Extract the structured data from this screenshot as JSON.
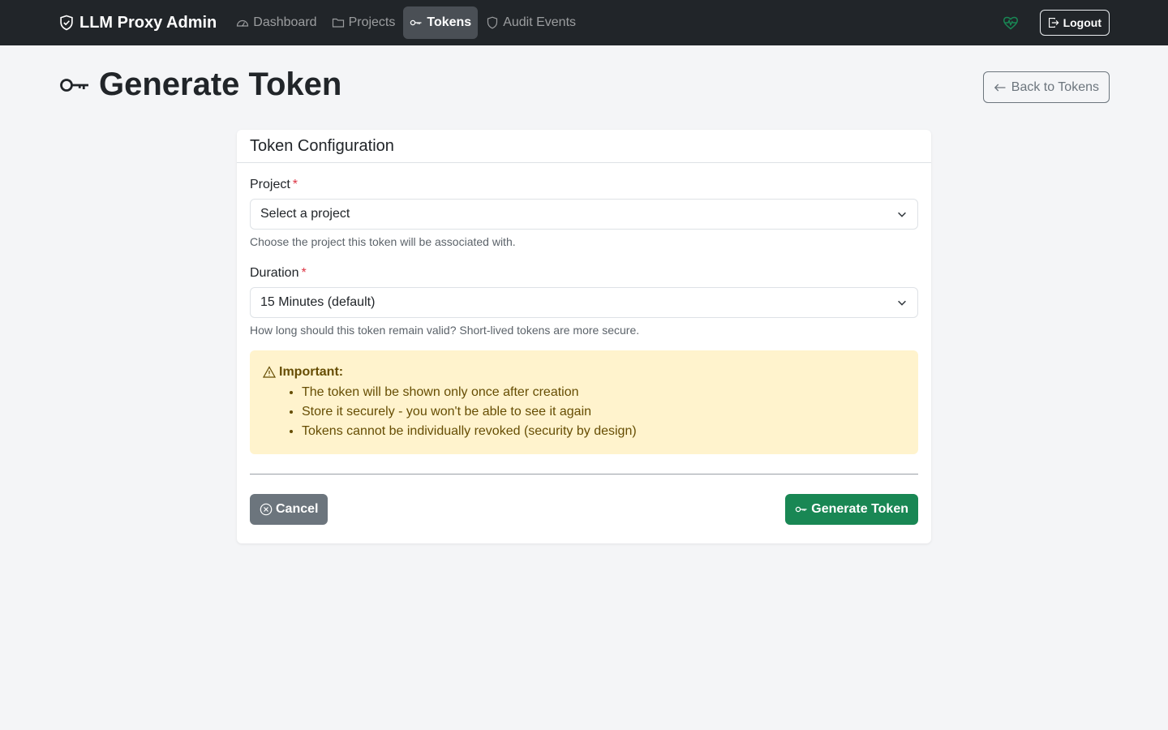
{
  "navbar": {
    "brand": "LLM Proxy Admin",
    "links": [
      {
        "label": "Dashboard",
        "icon": "speedometer-icon",
        "active": false
      },
      {
        "label": "Projects",
        "icon": "folder-icon",
        "active": false
      },
      {
        "label": "Tokens",
        "icon": "key-icon",
        "active": true
      },
      {
        "label": "Audit Events",
        "icon": "shield-icon",
        "active": false
      }
    ],
    "health_icon": "heart-pulse-icon",
    "logout_label": "Logout"
  },
  "page": {
    "title": "Generate Token",
    "back_label": "Back to Tokens"
  },
  "card": {
    "header": "Token Configuration",
    "project": {
      "label": "Project",
      "required_mark": "*",
      "value": "Select a project",
      "help": "Choose the project this token will be associated with."
    },
    "duration": {
      "label": "Duration",
      "required_mark": "*",
      "value": "15 Minutes (default)",
      "help": "How long should this token remain valid? Short-lived tokens are more secure."
    },
    "alert": {
      "title": "Important:",
      "items": [
        "The token will be shown only once after creation",
        "Store it securely - you won't be able to see it again",
        "Tokens cannot be individually revoked (security by design)"
      ]
    },
    "cancel_label": "Cancel",
    "generate_label": "Generate Token"
  },
  "colors": {
    "navbar_bg": "#212529",
    "success": "#198754",
    "secondary": "#6c757d",
    "warning_bg": "#fff3cd",
    "danger": "#dc3545"
  }
}
